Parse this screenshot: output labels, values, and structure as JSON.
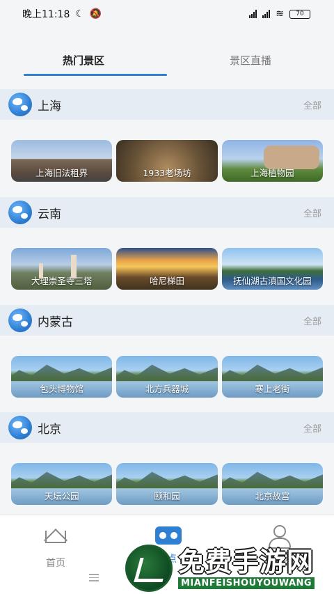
{
  "status": {
    "time": "晚上11:18",
    "battery": "70"
  },
  "tabs": [
    {
      "label": "热门景区"
    },
    {
      "label": "景区直播"
    }
  ],
  "sections": [
    {
      "title": "上海",
      "all": "全部",
      "cards": [
        "上海旧法租界",
        "1933老场坊",
        "上海植物园"
      ]
    },
    {
      "title": "云南",
      "all": "全部",
      "cards": [
        "大理崇圣寺三塔",
        "哈尼梯田",
        "抚仙湖古滇国文化园"
      ]
    },
    {
      "title": "内蒙古",
      "all": "全部",
      "cards": [
        "包头博物馆",
        "北方兵器城",
        "寒上老街"
      ]
    },
    {
      "title": "北京",
      "all": "全部",
      "cards": [
        "天坛公园",
        "颐和园",
        "北京故宫"
      ]
    }
  ],
  "bottom_nav": [
    {
      "label": "首页"
    },
    {
      "label": "景点"
    },
    {
      "label": "我的"
    }
  ],
  "watermark": {
    "cn": "免费手游网",
    "en": "MIANFEISHOUYOUWANG"
  },
  "colors": {
    "accent": "#2f7fd3",
    "section_bg": "#e6ecf3"
  }
}
